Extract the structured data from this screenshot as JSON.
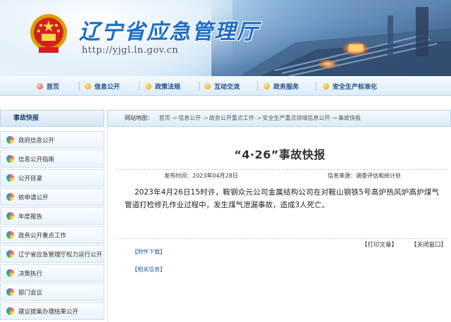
{
  "header": {
    "site_title": "辽宁省应急管理厅",
    "site_url": "http://yjgl.ln.gov.cn"
  },
  "nav": {
    "items": [
      {
        "label": "首页",
        "active": true
      },
      {
        "label": "信息公开"
      },
      {
        "label": "政策法规"
      },
      {
        "label": "互动交流"
      },
      {
        "label": "政务服务"
      },
      {
        "label": "安全生产标准化"
      }
    ]
  },
  "sidebar": {
    "heading": "事故快报",
    "items": [
      {
        "label": "政府信息公开"
      },
      {
        "label": "信息公开指南"
      },
      {
        "label": "公开目录"
      },
      {
        "label": "依申请公开"
      },
      {
        "label": "年度报告"
      },
      {
        "label": "政务公开重点工作"
      },
      {
        "label": "辽宁省应急管理厅权力运行公开"
      },
      {
        "label": "决策执行"
      },
      {
        "label": "部门会议"
      },
      {
        "label": "建议提案办理结果公开"
      }
    ]
  },
  "breadcrumb": {
    "label": "网站地图：",
    "items": [
      "首页",
      "信息公开",
      "政务公开重点工作",
      "安全生产重点领域信息公开",
      "事故快报"
    ],
    "separator": "->"
  },
  "article": {
    "title": "“4·26”事故快报",
    "publish_time": "发布时间：2023年04月28日",
    "source": "信息来源：调查评估和统计处",
    "body": "2023年4月26日15时许，鞍钢众元公司金属结构公司在对鞍山钢铁5号高炉热风炉高炉煤气管道打检修孔作业过程中，发生煤气泄漏事故，造成3人死亡。",
    "print_label": "【打印文章】",
    "close_label": "【关闭窗口】",
    "attachments_label": "【附件下载】",
    "related_label": "【相关信息】"
  },
  "colors": {
    "title_blue": "#1c6ec8",
    "nav_text": "#1f4f86",
    "link_blue": "#2a5d98"
  }
}
